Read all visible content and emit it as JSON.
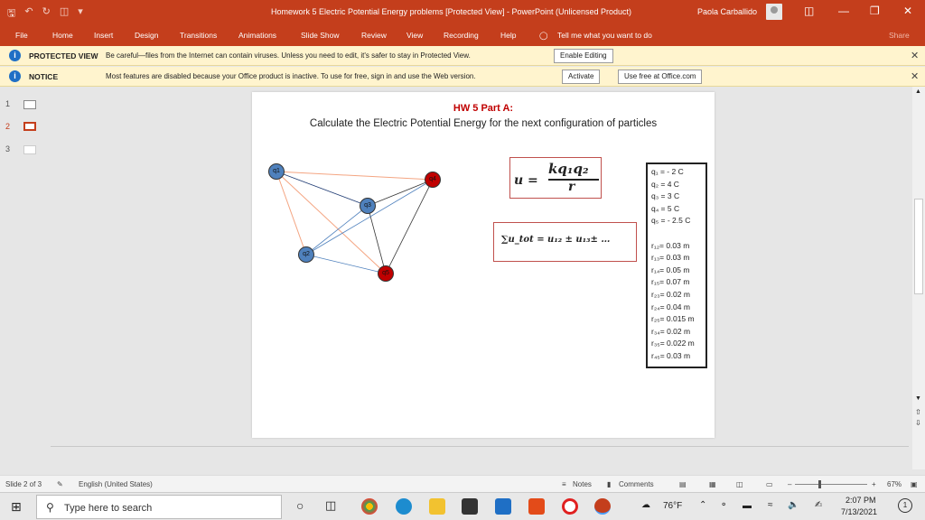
{
  "window": {
    "title": "Homework 5 Electric Potential Energy problems [Protected View]  -  PowerPoint (Unlicensed Product)",
    "user": "Paola Carballido"
  },
  "ribbon_tabs": [
    "File",
    "Home",
    "Insert",
    "Design",
    "Transitions",
    "Animations",
    "Slide Show",
    "Review",
    "View",
    "Recording",
    "Help"
  ],
  "tell_me": "Tell me what you want to do",
  "share": "Share",
  "protected_bar": {
    "label": "PROTECTED VIEW",
    "text": "Be careful—files from the Internet can contain viruses. Unless you need to edit, it's safer to stay in Protected View.",
    "button": "Enable Editing"
  },
  "notice_bar": {
    "label": "NOTICE",
    "text": "Most features are disabled because your Office product is inactive. To use for free, sign in and use the Web version.",
    "button1": "Activate",
    "button2": "Use free at Office.com"
  },
  "thumbnails": [
    "1",
    "2",
    "3"
  ],
  "slide": {
    "title": "HW 5 Part A:",
    "subtitle": "Calculate the Electric Potential Energy for the next configuration of particles",
    "particles": {
      "q1": "q1",
      "q2": "q2",
      "q3": "q3",
      "q4": "q4",
      "q5": "q5"
    },
    "formula_u_lhs": "u =",
    "formula_u_num": "kq₁q₂",
    "formula_u_den": "r",
    "formula_sum": "∑u_tot = u₁₂ ± u₁₃± …",
    "values": [
      "q₁ = - 2 C",
      "q₂ =  4 C",
      "q₃ = 3 C",
      "q₄ = 5 C",
      "q₅ = - 2.5 C",
      "",
      "r₁₂= 0.03 m",
      "r₁₃= 0.03 m",
      "r₁₄= 0.05 m",
      "r₁₅= 0.07 m",
      "r₂₃= 0.02 m",
      "r₂₄= 0.04 m",
      "r₂₅= 0.015 m",
      "r₃₄= 0.02 m",
      "r₃₅= 0.022 m",
      "r₄₅= 0.03 m"
    ]
  },
  "status": {
    "slide": "Slide 2 of 3",
    "language": "English (United States)",
    "notes": "Notes",
    "comments": "Comments",
    "zoom": "67%"
  },
  "taskbar": {
    "search_placeholder": "Type here to search",
    "weather": "76°F",
    "time": "2:07 PM",
    "date": "7/13/2021",
    "notif_count": "1"
  },
  "colors": {
    "accent": "#c43e1c",
    "positive": "#4f81bd",
    "negative": "#c00000"
  }
}
